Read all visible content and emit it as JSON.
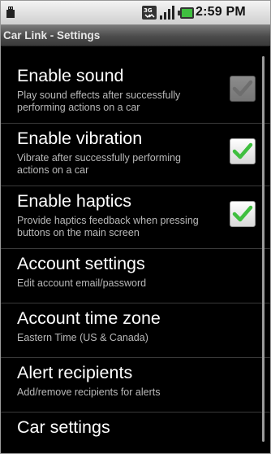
{
  "status_bar": {
    "time": "2:59 PM",
    "icons": [
      "usb-icon",
      "3g-icon",
      "signal-icon",
      "battery-icon"
    ]
  },
  "title_bar": {
    "title": "Car Link - Settings"
  },
  "settings": [
    {
      "title": "Enable sound",
      "summary": "Play sound effects after successfully performing actions on a car",
      "checkbox": true,
      "checked": true,
      "enabled": false
    },
    {
      "title": "Enable vibration",
      "summary": "Vibrate after successfully performing actions on a car",
      "checkbox": true,
      "checked": true,
      "enabled": true
    },
    {
      "title": "Enable haptics",
      "summary": "Provide haptics feedback when pressing buttons on the main screen",
      "checkbox": true,
      "checked": true,
      "enabled": true
    },
    {
      "title": "Account settings",
      "summary": "Edit account email/password"
    },
    {
      "title": "Account time zone",
      "summary": "Eastern Time (US & Canada)"
    },
    {
      "title": "Alert recipients",
      "summary": "Add/remove recipients for alerts"
    },
    {
      "title": "Car settings",
      "summary": ""
    }
  ],
  "colors": {
    "check": "#3fbf3f",
    "summary_text": "#b9b9b9"
  }
}
